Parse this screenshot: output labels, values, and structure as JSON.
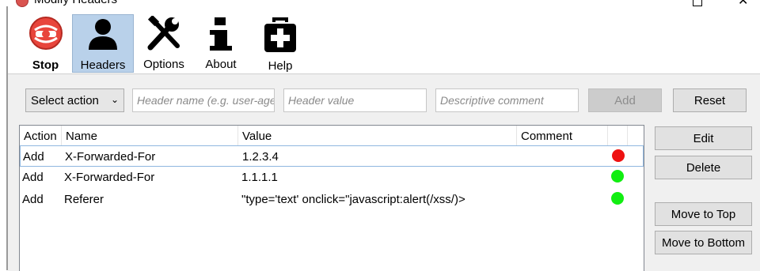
{
  "window": {
    "title": "Modify Headers"
  },
  "toolbar": {
    "stop": {
      "label": "Stop"
    },
    "headers": {
      "label": "Headers"
    },
    "options": {
      "label": "Options"
    },
    "about": {
      "label": "About"
    },
    "help": {
      "label": "Help"
    }
  },
  "form": {
    "action_select": {
      "value": "Select action"
    },
    "header_name": {
      "placeholder": "Header name (e.g. user-agent)"
    },
    "header_value": {
      "placeholder": "Header value"
    },
    "comment": {
      "placeholder": "Descriptive comment"
    },
    "add_label": "Add",
    "reset_label": "Reset"
  },
  "side_buttons": {
    "edit": "Edit",
    "delete": "Delete",
    "move_top": "Move to Top",
    "move_bottom": "Move to Bottom"
  },
  "table": {
    "columns": [
      "Action",
      "Name",
      "Value",
      "Comment",
      ""
    ],
    "rows": [
      {
        "action": "Add",
        "name": "X-Forwarded-For",
        "value": "1.2.3.4",
        "comment": "",
        "status": "disabled",
        "status_color": "#ee1111"
      },
      {
        "action": "Add",
        "name": "X-Forwarded-For",
        "value": "1.1.1.1",
        "comment": "",
        "status": "enabled",
        "status_color": "#11ee11"
      },
      {
        "action": "Add",
        "name": "Referer",
        "value": "\"type='text' onclick=\"javascript:alert(/xss/)>",
        "comment": "",
        "status": "enabled",
        "status_color": "#11ee11"
      }
    ]
  },
  "colors": {
    "selected_tab": "#b9d1ea",
    "panel": "#f0f0f0"
  }
}
